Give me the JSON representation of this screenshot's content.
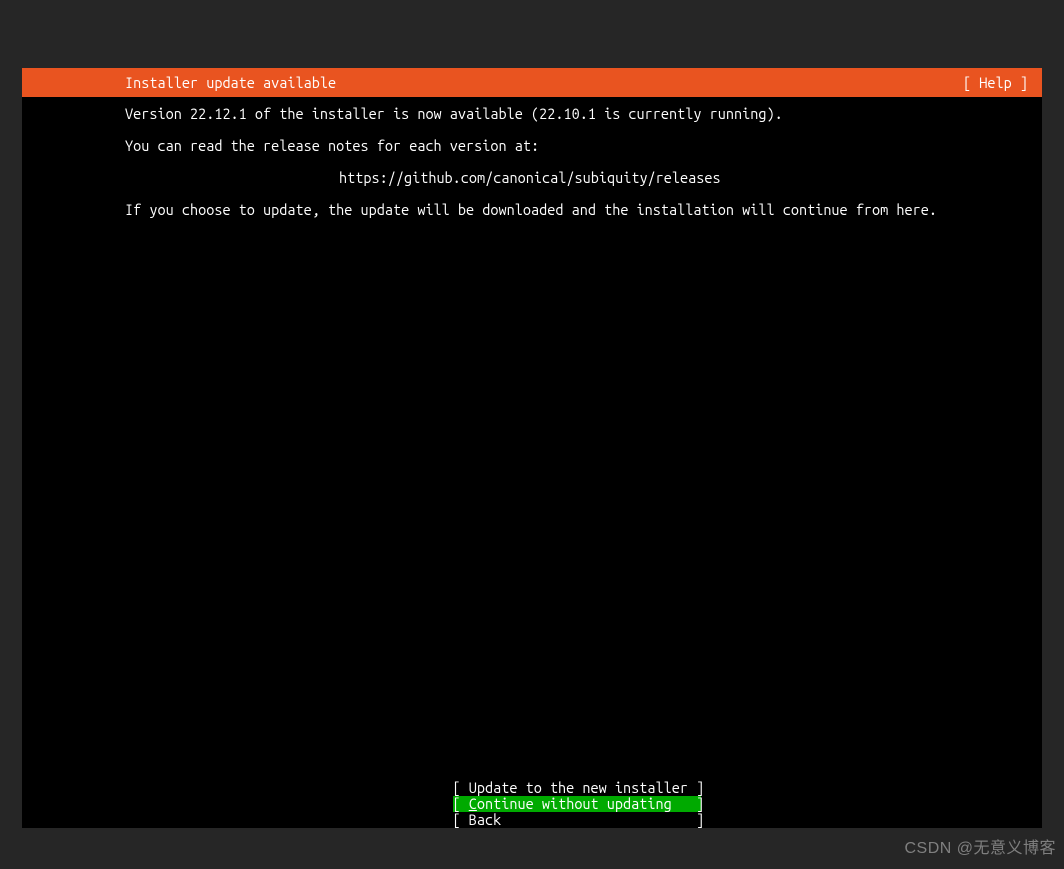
{
  "header": {
    "title": "Installer update available",
    "help_label": "[ Help ]"
  },
  "content": {
    "line1": "Version 22.12.1 of the installer is now available (22.10.1 is currently running).",
    "line2": "You can read the release notes for each version at:",
    "url": "https://github.com/canonical/subiquity/releases",
    "line3": "If you choose to update, the update will be downloaded and the installation will continue from here."
  },
  "buttons": {
    "update": "[ Update to the new installer ]",
    "continue_prefix": "[ ",
    "continue_underline": "C",
    "continue_rest": "ontinue without updating   ]",
    "back": "[ Back                        ]"
  },
  "watermark": "CSDN @无意义博客"
}
